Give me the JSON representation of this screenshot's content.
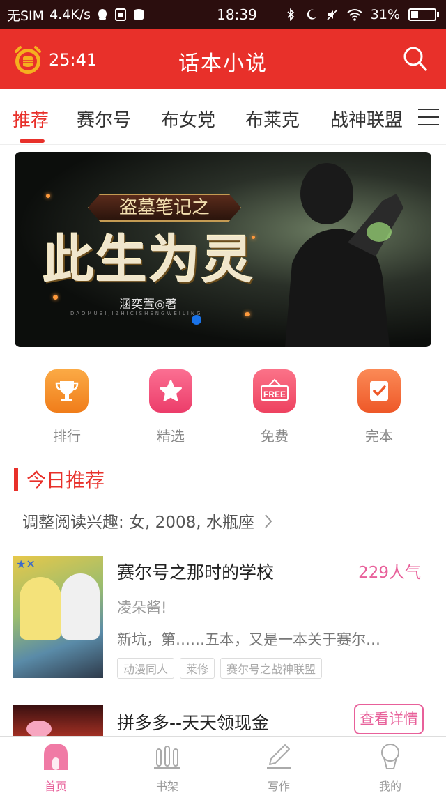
{
  "status_bar": {
    "carrier": "无SIM",
    "speed": "4.4K/s",
    "time": "18:39",
    "battery": "31%"
  },
  "app_bar": {
    "timer": "25:41",
    "title": "话本小说"
  },
  "tabs": [
    {
      "label": "推荐",
      "active": true
    },
    {
      "label": "赛尔号",
      "active": false
    },
    {
      "label": "布女党",
      "active": false
    },
    {
      "label": "布莱克",
      "active": false
    },
    {
      "label": "战神联盟",
      "active": false
    }
  ],
  "banner": {
    "subtitle": "盗墓笔记之",
    "title": "此生为灵",
    "author": "涵奕萱◎著",
    "pinyin": "DAOMUBIJIZHICISHENGWEILING"
  },
  "quick_entries": [
    {
      "label": "排行",
      "icon": "trophy-icon",
      "color": "#f7962e"
    },
    {
      "label": "精选",
      "icon": "star-icon",
      "color": "#f2557c"
    },
    {
      "label": "免费",
      "icon": "free-tag-icon",
      "color": "#f25a70"
    },
    {
      "label": "完本",
      "icon": "check-note-icon",
      "color": "#f36c3c"
    }
  ],
  "today": {
    "title": "今日推荐",
    "interest": "调整阅读兴趣: 女, 2008, 水瓶座"
  },
  "book": {
    "title": "赛尔号之那时的学校",
    "popularity": "229人气",
    "author": "凌朵酱!",
    "description": "新坑，第……五本，又是一本关于赛尔…",
    "tags": [
      "动漫同人",
      "莱修",
      "赛尔号之战神联盟"
    ]
  },
  "ad": {
    "title": "拼多多--天天领现金",
    "button": "查看详情"
  },
  "bottom_nav": [
    {
      "label": "首页",
      "icon": "home-icon",
      "active": true
    },
    {
      "label": "书架",
      "icon": "bookshelf-icon",
      "active": false
    },
    {
      "label": "写作",
      "icon": "pen-icon",
      "active": false
    },
    {
      "label": "我的",
      "icon": "profile-icon",
      "active": false
    }
  ],
  "colors": {
    "brand_red": "#e8302a",
    "pink": "#e8609a",
    "status_bar": "#2b0e0e"
  }
}
